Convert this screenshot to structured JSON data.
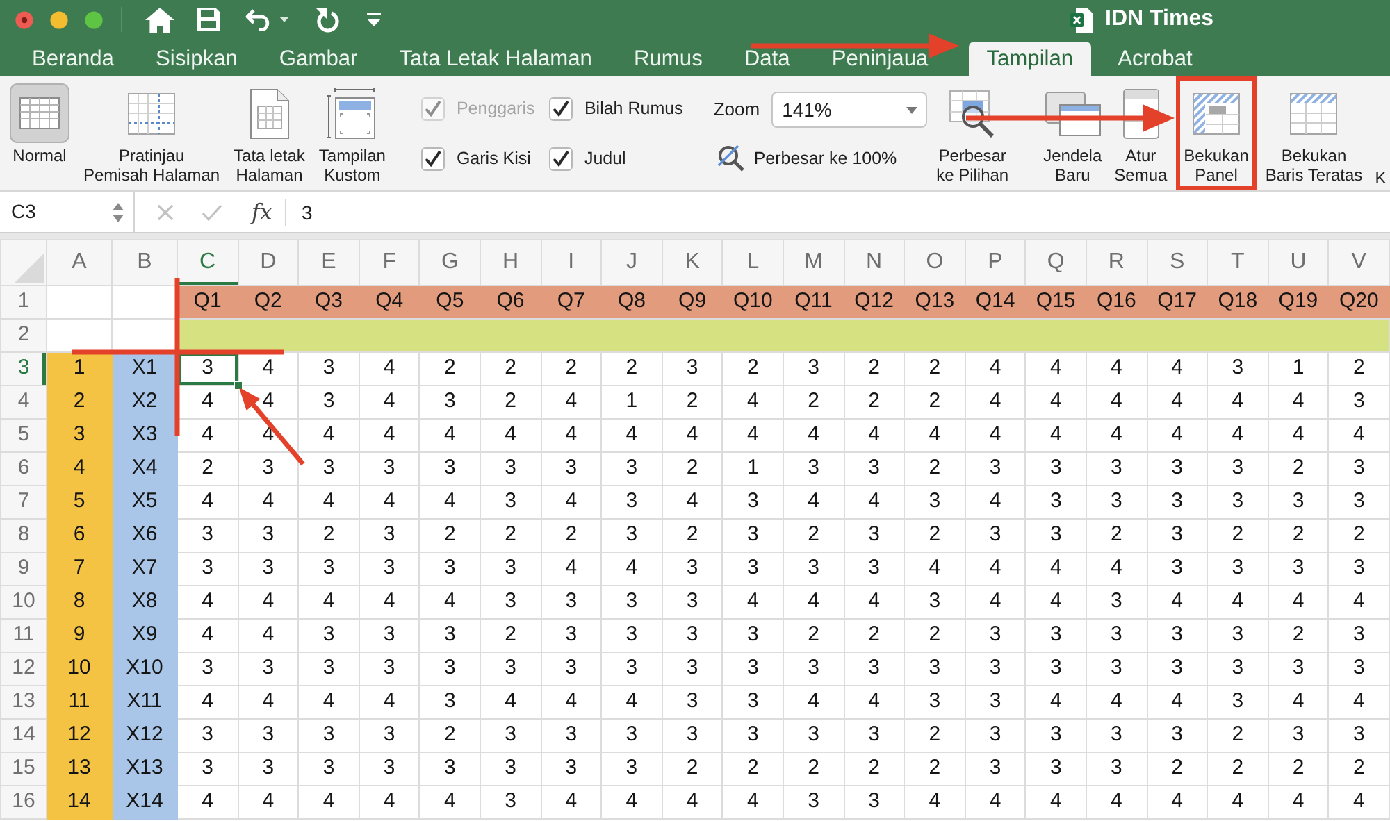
{
  "window": {
    "title": "IDN Times"
  },
  "ribbon_tabs": [
    {
      "label": "Beranda",
      "selected": false
    },
    {
      "label": "Sisipkan",
      "selected": false
    },
    {
      "label": "Gambar",
      "selected": false
    },
    {
      "label": "Tata Letak Halaman",
      "selected": false
    },
    {
      "label": "Rumus",
      "selected": false
    },
    {
      "label": "Data",
      "selected": false
    },
    {
      "label": "Peninjaua",
      "selected": false
    },
    {
      "label": "Tampilan",
      "selected": true
    },
    {
      "label": "Acrobat",
      "selected": false
    }
  ],
  "ribbon": {
    "view_buttons": [
      {
        "kind": "normal",
        "lines": [
          "Normal"
        ],
        "selected": true
      },
      {
        "kind": "page_break",
        "lines": [
          "Pratinjau",
          "Pemisah Halaman"
        ],
        "selected": false
      },
      {
        "kind": "page_layout",
        "lines": [
          "Tata letak",
          "Halaman"
        ],
        "selected": false
      },
      {
        "kind": "custom",
        "lines": [
          "Tampilan",
          "Kustom"
        ],
        "selected": false
      }
    ],
    "show_options": [
      {
        "label": "Penggaris",
        "checked": true,
        "disabled": true
      },
      {
        "label": "Bilah Rumus",
        "checked": true,
        "disabled": false
      },
      {
        "label": "Garis Kisi",
        "checked": true,
        "disabled": false
      },
      {
        "label": "Judul",
        "checked": true,
        "disabled": false
      }
    ],
    "zoom": {
      "label": "Zoom",
      "value": "141%"
    },
    "zoom_to_100": {
      "label": "Perbesar ke 100%"
    },
    "zoom_to_selection": {
      "lines": [
        "Perbesar",
        "ke Pilihan"
      ]
    },
    "window_buttons": [
      {
        "kind": "new_window",
        "lines": [
          "Jendela",
          "Baru"
        ],
        "highlighted": false
      },
      {
        "kind": "arrange",
        "lines": [
          "Atur",
          "Semua"
        ],
        "highlighted": false
      },
      {
        "kind": "freeze_panes",
        "lines": [
          "Bekukan",
          "Panel"
        ],
        "highlighted": true
      },
      {
        "kind": "freeze_top_row",
        "lines": [
          "Bekukan",
          "Baris Teratas"
        ],
        "highlighted": false
      },
      {
        "kind": "clipped",
        "lines": [
          "K"
        ],
        "highlighted": false
      }
    ]
  },
  "formula_bar": {
    "name_box": "C3",
    "function_symbol": "fx",
    "value": "3"
  },
  "sheet": {
    "columns": [
      {
        "label": "A",
        "selected": false
      },
      {
        "label": "B",
        "selected": false
      },
      {
        "label": "C",
        "selected": true
      },
      {
        "label": "D",
        "selected": false
      },
      {
        "label": "E",
        "selected": false
      },
      {
        "label": "F",
        "selected": false
      },
      {
        "label": "G",
        "selected": false
      },
      {
        "label": "H",
        "selected": false
      },
      {
        "label": "I",
        "selected": false
      },
      {
        "label": "J",
        "selected": false
      },
      {
        "label": "K",
        "selected": false
      },
      {
        "label": "L",
        "selected": false
      },
      {
        "label": "M",
        "selected": false
      },
      {
        "label": "N",
        "selected": false
      },
      {
        "label": "O",
        "selected": false
      },
      {
        "label": "P",
        "selected": false
      },
      {
        "label": "Q",
        "selected": false
      },
      {
        "label": "R",
        "selected": false
      },
      {
        "label": "S",
        "selected": false
      },
      {
        "label": "T",
        "selected": false
      },
      {
        "label": "U",
        "selected": false
      },
      {
        "label": "V",
        "selected": false
      }
    ],
    "rows": [
      {
        "number": "1",
        "kind": "questions",
        "selected": false,
        "cells": [
          "Q1",
          "Q2",
          "Q3",
          "Q4",
          "Q5",
          "Q6",
          "Q7",
          "Q8",
          "Q9",
          "Q10",
          "Q11",
          "Q12",
          "Q13",
          "Q14",
          "Q15",
          "Q16",
          "Q17",
          "Q18",
          "Q19",
          "Q20"
        ]
      },
      {
        "number": "2",
        "kind": "band",
        "selected": false
      },
      {
        "number": "3",
        "kind": "data",
        "selected": true,
        "index": "1",
        "code": "X1",
        "values": [
          "3",
          "4",
          "3",
          "4",
          "2",
          "2",
          "2",
          "2",
          "3",
          "2",
          "3",
          "2",
          "2",
          "4",
          "4",
          "4",
          "4",
          "3",
          "1",
          "2"
        ]
      },
      {
        "number": "4",
        "kind": "data",
        "selected": false,
        "index": "2",
        "code": "X2",
        "values": [
          "4",
          "4",
          "3",
          "4",
          "3",
          "2",
          "4",
          "1",
          "2",
          "4",
          "2",
          "2",
          "2",
          "4",
          "4",
          "4",
          "4",
          "4",
          "4",
          "3"
        ]
      },
      {
        "number": "5",
        "kind": "data",
        "selected": false,
        "index": "3",
        "code": "X3",
        "values": [
          "4",
          "4",
          "4",
          "4",
          "4",
          "4",
          "4",
          "4",
          "4",
          "4",
          "4",
          "4",
          "4",
          "4",
          "4",
          "4",
          "4",
          "4",
          "4",
          "4"
        ]
      },
      {
        "number": "6",
        "kind": "data",
        "selected": false,
        "index": "4",
        "code": "X4",
        "values": [
          "2",
          "3",
          "3",
          "3",
          "3",
          "3",
          "3",
          "3",
          "2",
          "1",
          "3",
          "3",
          "2",
          "3",
          "3",
          "3",
          "3",
          "3",
          "2",
          "3"
        ]
      },
      {
        "number": "7",
        "kind": "data",
        "selected": false,
        "index": "5",
        "code": "X5",
        "values": [
          "4",
          "4",
          "4",
          "4",
          "4",
          "3",
          "4",
          "3",
          "4",
          "3",
          "4",
          "4",
          "3",
          "4",
          "3",
          "3",
          "3",
          "3",
          "3",
          "3"
        ]
      },
      {
        "number": "8",
        "kind": "data",
        "selected": false,
        "index": "6",
        "code": "X6",
        "values": [
          "3",
          "3",
          "2",
          "3",
          "2",
          "2",
          "2",
          "3",
          "2",
          "3",
          "2",
          "3",
          "2",
          "3",
          "3",
          "2",
          "3",
          "2",
          "2",
          "2"
        ]
      },
      {
        "number": "9",
        "kind": "data",
        "selected": false,
        "index": "7",
        "code": "X7",
        "values": [
          "3",
          "3",
          "3",
          "3",
          "3",
          "3",
          "4",
          "4",
          "3",
          "3",
          "3",
          "3",
          "4",
          "4",
          "4",
          "4",
          "3",
          "3",
          "3",
          "3"
        ]
      },
      {
        "number": "10",
        "kind": "data",
        "selected": false,
        "index": "8",
        "code": "X8",
        "values": [
          "4",
          "4",
          "4",
          "4",
          "4",
          "3",
          "3",
          "3",
          "3",
          "4",
          "4",
          "4",
          "3",
          "4",
          "4",
          "3",
          "4",
          "4",
          "4",
          "4"
        ]
      },
      {
        "number": "11",
        "kind": "data",
        "selected": false,
        "index": "9",
        "code": "X9",
        "values": [
          "4",
          "4",
          "3",
          "3",
          "3",
          "2",
          "3",
          "3",
          "3",
          "3",
          "2",
          "2",
          "2",
          "3",
          "3",
          "3",
          "3",
          "3",
          "2",
          "3"
        ]
      },
      {
        "number": "12",
        "kind": "data",
        "selected": false,
        "index": "10",
        "code": "X10",
        "values": [
          "3",
          "3",
          "3",
          "3",
          "3",
          "3",
          "3",
          "3",
          "3",
          "3",
          "3",
          "3",
          "3",
          "3",
          "3",
          "3",
          "3",
          "3",
          "3",
          "3"
        ]
      },
      {
        "number": "13",
        "kind": "data",
        "selected": false,
        "index": "11",
        "code": "X11",
        "values": [
          "4",
          "4",
          "4",
          "4",
          "3",
          "4",
          "4",
          "4",
          "3",
          "3",
          "4",
          "4",
          "3",
          "3",
          "4",
          "4",
          "4",
          "3",
          "4",
          "4"
        ]
      },
      {
        "number": "14",
        "kind": "data",
        "selected": false,
        "index": "12",
        "code": "X12",
        "values": [
          "3",
          "3",
          "3",
          "3",
          "2",
          "3",
          "3",
          "3",
          "3",
          "3",
          "3",
          "3",
          "2",
          "3",
          "3",
          "3",
          "3",
          "2",
          "3",
          "3"
        ]
      },
      {
        "number": "15",
        "kind": "data",
        "selected": false,
        "index": "13",
        "code": "X13",
        "values": [
          "3",
          "3",
          "3",
          "3",
          "3",
          "3",
          "3",
          "3",
          "2",
          "2",
          "2",
          "2",
          "2",
          "3",
          "3",
          "3",
          "2",
          "2",
          "2",
          "2"
        ]
      },
      {
        "number": "16",
        "kind": "data",
        "selected": false,
        "index": "14",
        "code": "X14",
        "values": [
          "4",
          "4",
          "4",
          "4",
          "4",
          "3",
          "4",
          "4",
          "4",
          "4",
          "3",
          "3",
          "4",
          "4",
          "4",
          "4",
          "4",
          "4",
          "4",
          "4"
        ]
      }
    ]
  }
}
